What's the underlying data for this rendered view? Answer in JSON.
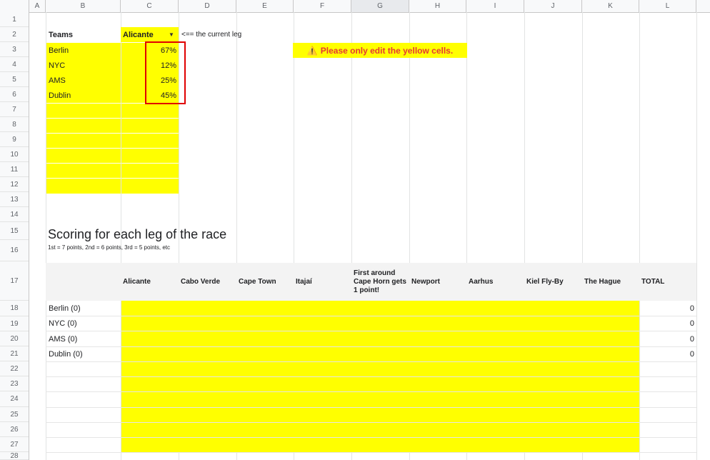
{
  "columns": [
    "A",
    "B",
    "C",
    "D",
    "E",
    "F",
    "G",
    "H",
    "I",
    "J",
    "K",
    "L"
  ],
  "rows": [
    "1",
    "2",
    "3",
    "4",
    "5",
    "6",
    "7",
    "8",
    "9",
    "10",
    "11",
    "12",
    "13",
    "14",
    "15",
    "16",
    "17",
    "18",
    "19",
    "20",
    "21",
    "22",
    "23",
    "24",
    "25",
    "26",
    "27",
    "28"
  ],
  "top_table": {
    "header_label": "Teams",
    "current_leg": "Alicante",
    "note": "<== the current leg",
    "teams": [
      {
        "name": "Berlin",
        "pct": "67%"
      },
      {
        "name": "NYC",
        "pct": "12%"
      },
      {
        "name": "AMS",
        "pct": "25%"
      },
      {
        "name": "Dublin",
        "pct": "45%"
      }
    ]
  },
  "warning": {
    "icon": "warning-icon",
    "text": "Please only edit the yellow cells."
  },
  "scoring": {
    "title": "Scoring for each leg of the race",
    "subtitle": "1st = 7 points, 2nd = 6 points, 3rd = 5 points, etc",
    "legs": [
      "Alicante",
      "Cabo Verde",
      "Cape Town",
      "Itajaí",
      "First around Cape Horn gets 1 point!",
      "Newport",
      "Aarhus",
      "Kiel Fly-By",
      "The Hague"
    ],
    "total_label": "TOTAL",
    "team_rows": [
      {
        "name": "Berlin (0)",
        "total": "0"
      },
      {
        "name": "NYC (0)",
        "total": "0"
      },
      {
        "name": "AMS (0)",
        "total": "0"
      },
      {
        "name": "Dublin (0)",
        "total": "0"
      }
    ]
  }
}
